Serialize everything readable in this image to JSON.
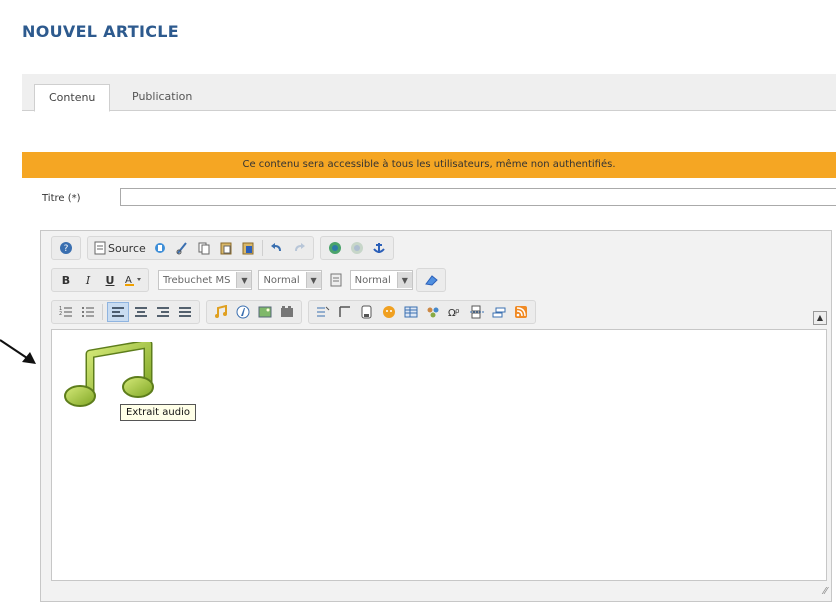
{
  "page": {
    "title": "NOUVEL ARTICLE"
  },
  "tabs": [
    {
      "label": "Contenu",
      "active": true
    },
    {
      "label": "Publication",
      "active": false
    }
  ],
  "notice": {
    "text": "Ce contenu sera accessible à tous les utilisateurs, même non authentifiés.",
    "color": "#f5a623"
  },
  "form": {
    "title_label": "Titre (*)",
    "title_value": ""
  },
  "editor": {
    "toolbar": {
      "source_label": "Source",
      "font_name": "Trebuchet MS",
      "font_size": "Normal",
      "format": "Normal",
      "bold": "B",
      "italic": "I",
      "underline": "U"
    },
    "audio_tooltip": "Extrait audio"
  },
  "colors": {
    "accent": "#2d5a8e",
    "notice_bg": "#f5a623",
    "music_green": "#9dc43a"
  }
}
